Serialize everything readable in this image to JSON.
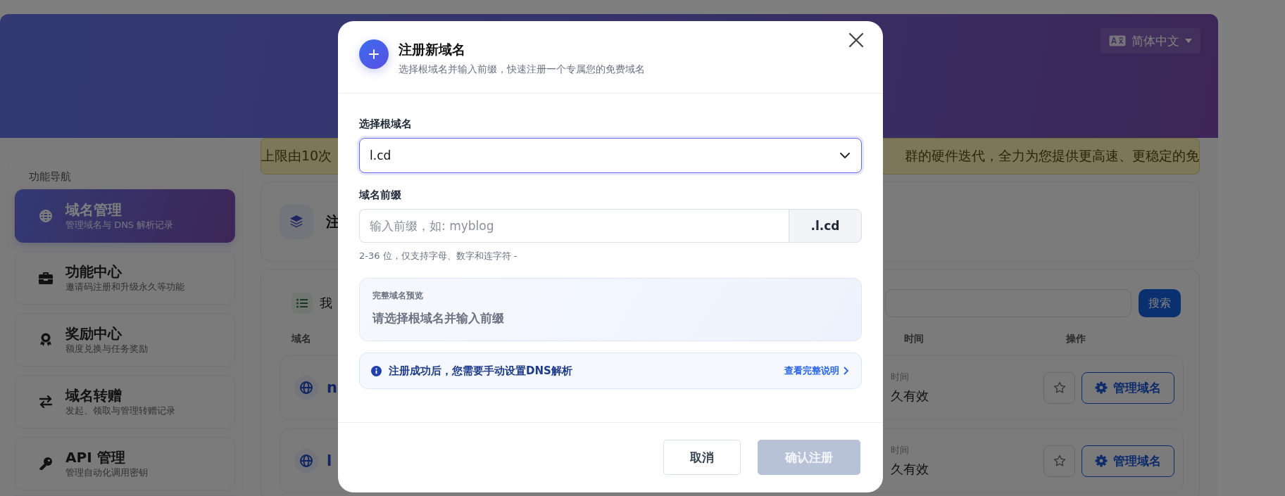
{
  "header": {
    "language": "简体中文"
  },
  "notice": {
    "text_left": "上限由10次",
    "text_right": "群的硬件迭代，全力为您提供更高速、更稳定的免"
  },
  "sidebar": {
    "title": "功能导航",
    "items": [
      {
        "title": "域名管理",
        "subtitle": "管理域名与 DNS 解析记录",
        "selected": true
      },
      {
        "title": "功能中心",
        "subtitle": "邀请码注册和升级永久等功能",
        "selected": false
      },
      {
        "title": "奖励中心",
        "subtitle": "额度兑换与任务奖励",
        "selected": false
      },
      {
        "title": "域名转赠",
        "subtitle": "发起、领取与管理转赠记录",
        "selected": false
      },
      {
        "title": "API 管理",
        "subtitle": "管理自动化调用密钥",
        "selected": false
      }
    ]
  },
  "register_card": {
    "title": "注"
  },
  "domain_list": {
    "title": "我",
    "search_button": "搜索",
    "columns": [
      "域名",
      "时间",
      "操作"
    ],
    "rows": [
      {
        "name": "n",
        "expiry_label": "时间",
        "expiry": "久有效",
        "favorite": false,
        "manage_button": "管理域名"
      },
      {
        "name": "l",
        "expiry_label": "时间",
        "expiry": "久有效",
        "favorite": false,
        "manage_button": "管理域名"
      }
    ]
  },
  "dialog": {
    "title": "注册新域名",
    "subtitle": "选择根域名并输入前缀，快速注册一个专属您的免费域名",
    "root_label": "选择根域名",
    "root_value": "l.cd",
    "prefix_label": "域名前缀",
    "prefix_placeholder": "输入前缀，如: myblog",
    "suffix": ".l.cd",
    "hint": "2-36 位，仅支持字母、数字和连字符 -",
    "preview_label": "完整域名预览",
    "preview_text": "请选择根域名并输入前缀",
    "info_text": "注册成功后，您需要手动设置DNS解析",
    "info_link": "查看完整说明",
    "cancel_button": "取消",
    "confirm_button": "确认注册",
    "confirm_disabled": true
  }
}
